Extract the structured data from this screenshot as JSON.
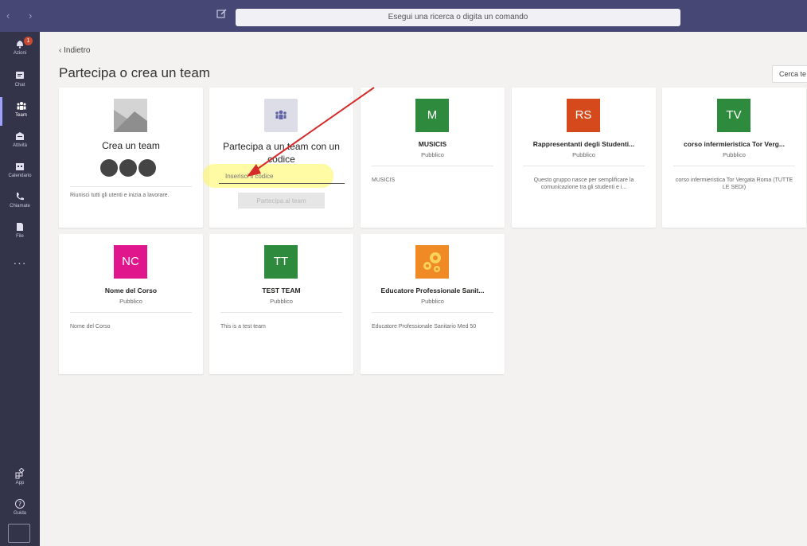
{
  "titlebar": {
    "nav_back": "‹",
    "nav_forward": "›",
    "search_placeholder": "Esegui una ricerca o digita un comando"
  },
  "rail": {
    "items": [
      {
        "label": "Azioni",
        "icon": "bell-icon",
        "badge": "1"
      },
      {
        "label": "Chat",
        "icon": "chat-icon"
      },
      {
        "label": "Team",
        "icon": "teams-icon",
        "active": true
      },
      {
        "label": "Attività",
        "icon": "assignments-icon"
      },
      {
        "label": "Calendario",
        "icon": "calendar-icon"
      },
      {
        "label": "Chiamate",
        "icon": "phone-icon"
      },
      {
        "label": "File",
        "icon": "file-icon"
      }
    ],
    "more": "···",
    "bottom": [
      {
        "label": "App",
        "icon": "apps-icon"
      },
      {
        "label": "Guida",
        "icon": "help-icon"
      }
    ]
  },
  "main": {
    "back_label": "Indietro",
    "title": "Partecipa o crea un team",
    "search_teams": "Cerca te"
  },
  "create_card": {
    "title": "Crea un team",
    "description": "Riunisci tutti gli utenti e inizia a lavorare."
  },
  "join_card": {
    "title": "Partecipa a un team con un codice",
    "input_placeholder": "Inserisci il codice",
    "button_label": "Partecipa al team"
  },
  "teams": [
    {
      "initials": "M",
      "color": "#2e8b3d",
      "name": "MUSICIS",
      "visibility": "Pubblico",
      "description": "MUSICIS"
    },
    {
      "initials": "RS",
      "color": "#d54a1d",
      "name": "Rappresentanti degli Studenti...",
      "visibility": "Pubblico",
      "description": "Questo gruppo nasce per semplificare la comunicazione tra gli studenti e i..."
    },
    {
      "initials": "TV",
      "color": "#2e8b3d",
      "name": "corso infermieristica Tor Verg...",
      "visibility": "Pubblico",
      "description": "corso infermieristica Tor Vergata Roma (TUTTE LE SEDI)"
    },
    {
      "initials": "NC",
      "color": "#e0168c",
      "name": "Nome del Corso",
      "visibility": "Pubblico",
      "description": "Nome del Corso"
    },
    {
      "initials": "TT",
      "color": "#2e8b3d",
      "name": "TEST TEAM",
      "visibility": "Pubblico",
      "description": "This is a test team"
    },
    {
      "initials": "",
      "color": "#f08a24",
      "icon": "gears-icon",
      "name": "Educatore Professionale Sanit...",
      "visibility": "Pubblico",
      "description": "Educatore Professionale Sanitario Med 50"
    }
  ]
}
